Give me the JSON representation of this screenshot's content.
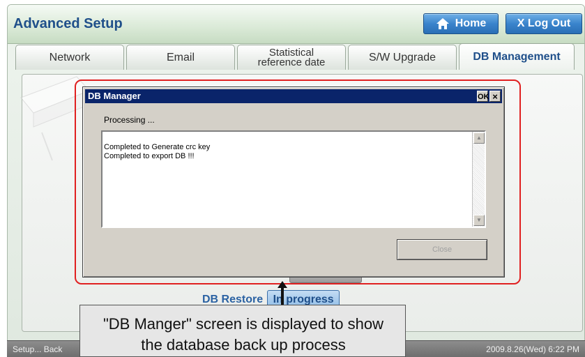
{
  "header": {
    "title": "Advanced Setup",
    "home_label": "Home",
    "logout_label": "X Log Out"
  },
  "tabs": [
    {
      "label": "Network"
    },
    {
      "label": "Email"
    },
    {
      "label_line1": "Statistical",
      "label_line2": "reference date"
    },
    {
      "label": "S/W Upgrade"
    },
    {
      "label": "DB Management",
      "active": true
    }
  ],
  "dialog": {
    "title": "DB Manager",
    "ok_label": "OK",
    "close_x": "×",
    "processing": "Processing ...",
    "log_lines": [
      "Completed to Generate crc key",
      "Completed to export DB !!!"
    ],
    "close_button": "Close"
  },
  "restore": {
    "label": "DB Restore",
    "status": "In progress"
  },
  "statusbar": {
    "left": "Setup... Back",
    "right": "2009.8.26(Wed)  6:22 PM"
  },
  "callout": {
    "line1": "\"DB Manger\" screen is displayed to show",
    "line2": "the database back up process"
  },
  "colors": {
    "header_title": "#1f4f8a",
    "dialog_titlebar": "#0a246a",
    "annotation_frame": "#e02020",
    "button_blue": "#3a84cc"
  },
  "icons": {
    "home": "house-icon"
  }
}
